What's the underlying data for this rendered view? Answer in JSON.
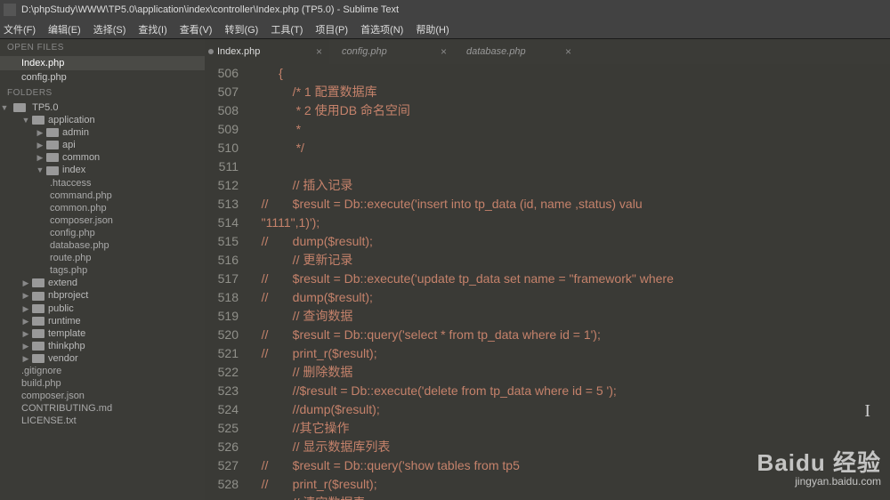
{
  "title": "D:\\phpStudy\\WWW\\TP5.0\\application\\index\\controller\\Index.php (TP5.0) - Sublime Text",
  "menu": [
    "文件(F)",
    "编辑(E)",
    "选择(S)",
    "查找(I)",
    "查看(V)",
    "转到(G)",
    "工具(T)",
    "项目(P)",
    "首选项(N)",
    "帮助(H)"
  ],
  "sidebar": {
    "openFilesHeader": "OPEN FILES",
    "openFiles": [
      "Index.php",
      "config.php"
    ],
    "foldersHeader": "FOLDERS",
    "root": "TP5.0",
    "tree": [
      {
        "d": 1,
        "t": "folder",
        "open": true,
        "name": "application"
      },
      {
        "d": 2,
        "t": "folder",
        "open": false,
        "name": "admin"
      },
      {
        "d": 2,
        "t": "folder",
        "open": false,
        "name": "api"
      },
      {
        "d": 2,
        "t": "folder",
        "open": false,
        "name": "common"
      },
      {
        "d": 2,
        "t": "folder",
        "open": true,
        "name": "index"
      },
      {
        "d": 3,
        "t": "file",
        "name": ".htaccess"
      },
      {
        "d": 3,
        "t": "file",
        "name": "command.php"
      },
      {
        "d": 3,
        "t": "file",
        "name": "common.php"
      },
      {
        "d": 3,
        "t": "file",
        "name": "composer.json"
      },
      {
        "d": 3,
        "t": "file",
        "name": "config.php"
      },
      {
        "d": 3,
        "t": "file",
        "name": "database.php"
      },
      {
        "d": 3,
        "t": "file",
        "name": "route.php"
      },
      {
        "d": 3,
        "t": "file",
        "name": "tags.php"
      },
      {
        "d": 1,
        "t": "folder",
        "open": false,
        "name": "extend"
      },
      {
        "d": 1,
        "t": "folder",
        "open": false,
        "name": "nbproject"
      },
      {
        "d": 1,
        "t": "folder",
        "open": false,
        "name": "public"
      },
      {
        "d": 1,
        "t": "folder",
        "open": false,
        "name": "runtime"
      },
      {
        "d": 1,
        "t": "folder",
        "open": false,
        "name": "template"
      },
      {
        "d": 1,
        "t": "folder",
        "open": false,
        "name": "thinkphp"
      },
      {
        "d": 1,
        "t": "folder",
        "open": false,
        "name": "vendor"
      },
      {
        "d": 1,
        "t": "file",
        "name": ".gitignore"
      },
      {
        "d": 1,
        "t": "file",
        "name": "build.php"
      },
      {
        "d": 1,
        "t": "file",
        "name": "composer.json"
      },
      {
        "d": 1,
        "t": "file",
        "name": "CONTRIBUTING.md"
      },
      {
        "d": 1,
        "t": "file",
        "name": "LICENSE.txt"
      }
    ]
  },
  "tabs": [
    {
      "label": "Index.php",
      "active": true,
      "dirty": true
    },
    {
      "label": "config.php",
      "active": false,
      "dirty": false
    },
    {
      "label": "database.php",
      "active": false,
      "dirty": false
    }
  ],
  "code": {
    "start": 506,
    "lines": [
      "        {",
      "            /* 1 配置数据库",
      "             * 2 使用DB 命名空间",
      "             *",
      "             */",
      "",
      "            // 插入记录",
      "   //       $result = Db::execute('insert into tp_data (id, name ,status) valu",
      "   \"1111\",1)');",
      "   //       dump($result);",
      "            // 更新记录",
      "   //       $result = Db::execute('update tp_data set name = \"framework\" where",
      "   //       dump($result);",
      "            // 查询数据",
      "   //       $result = Db::query('select * from tp_data where id = 1');",
      "   //       print_r($result);",
      "            // 删除数据",
      "            //$result = Db::execute('delete from tp_data where id = 5 ');",
      "            //dump($result);",
      "            //其它操作",
      "            // 显示数据库列表",
      "   //       $result = Db::query('show tables from tp5",
      "   //       print_r($result);",
      "            // 清空数据表"
    ]
  },
  "watermark": {
    "brand": "Baidu 经验",
    "sub": "jingyan.baidu.com"
  }
}
